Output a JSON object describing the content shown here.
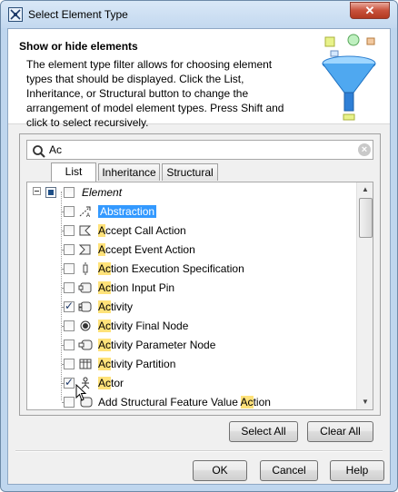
{
  "window": {
    "title": "Select Element Type",
    "close_glyph": "✕"
  },
  "header": {
    "title": "Show or hide elements",
    "description": "The element type filter allows for choosing element types that should be displayed. Click the List, Inheritance, or Structural button to change the arrangement of model element types. Press Shift and click to select recursively."
  },
  "search": {
    "value": "Ac",
    "placeholder": "",
    "clear_glyph": "×"
  },
  "tabs": [
    {
      "label": "List",
      "active": true
    },
    {
      "label": "Inheritance",
      "active": false
    },
    {
      "label": "Structural",
      "active": false
    }
  ],
  "tree": {
    "root": {
      "label": "Element"
    },
    "items": [
      {
        "pre": "Abstr",
        "match": "ac",
        "post": "tion",
        "checked": false,
        "selected": true,
        "icon": "abstraction-icon"
      },
      {
        "pre": "",
        "match": "A",
        "post": "ccept Call Action",
        "checked": false,
        "selected": false,
        "icon": "accept-call-action-icon"
      },
      {
        "pre": "",
        "match": "A",
        "post": "ccept Event Action",
        "checked": false,
        "selected": false,
        "icon": "accept-event-action-icon"
      },
      {
        "pre": "",
        "match": "Ac",
        "post": "tion Execution Specification",
        "checked": false,
        "selected": false,
        "icon": "action-execution-specification-icon"
      },
      {
        "pre": "",
        "match": "Ac",
        "post": "tion Input Pin",
        "checked": false,
        "selected": false,
        "icon": "action-input-pin-icon"
      },
      {
        "pre": "",
        "match": "Ac",
        "post": "tivity",
        "checked": true,
        "selected": false,
        "icon": "activity-icon"
      },
      {
        "pre": "",
        "match": "Ac",
        "post": "tivity Final Node",
        "checked": false,
        "selected": false,
        "icon": "activity-final-node-icon"
      },
      {
        "pre": "",
        "match": "Ac",
        "post": "tivity Parameter Node",
        "checked": false,
        "selected": false,
        "icon": "activity-parameter-node-icon"
      },
      {
        "pre": "",
        "match": "Ac",
        "post": "tivity Partition",
        "checked": false,
        "selected": false,
        "icon": "activity-partition-icon"
      },
      {
        "pre": "",
        "match": "Ac",
        "post": "tor",
        "checked": true,
        "selected": false,
        "icon": "actor-icon"
      },
      {
        "pre": "Add Structural Feature Value ",
        "match": "Ac",
        "post": "tion",
        "checked": false,
        "selected": false,
        "icon": "add-structural-feature-value-action-icon"
      }
    ]
  },
  "panel_buttons": {
    "select_all": "Select All",
    "clear_all": "Clear All"
  },
  "footer_buttons": {
    "ok": "OK",
    "cancel": "Cancel",
    "help": "Help"
  }
}
